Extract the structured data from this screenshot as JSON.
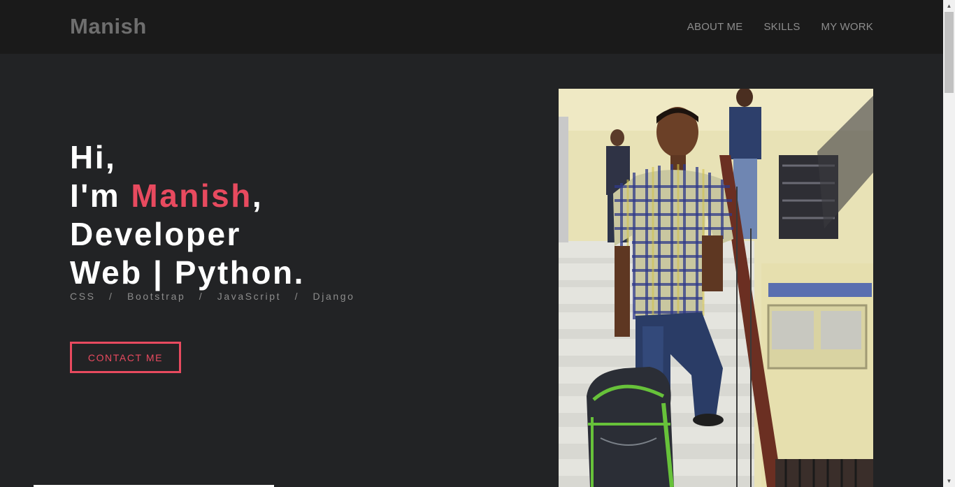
{
  "nav": {
    "brand": "Manish",
    "links": [
      "ABOUT ME",
      "SKILLS",
      "MY WORK"
    ]
  },
  "hero": {
    "line1": "Hi,",
    "line2_prefix": "I'm ",
    "line2_name": "Manish",
    "line2_suffix": ",",
    "line3": "Developer",
    "line4": "Web | Python.",
    "tech": "CSS   /   Bootstrap   /   JavaScript   /   Django",
    "button": "CONTACT ME"
  },
  "colors": {
    "accent": "#e84a5f",
    "background": "#222325",
    "navbar": "#1a1a1a"
  },
  "icons": {
    "scroll_up": "triangle-up",
    "scroll_down": "triangle-down"
  }
}
